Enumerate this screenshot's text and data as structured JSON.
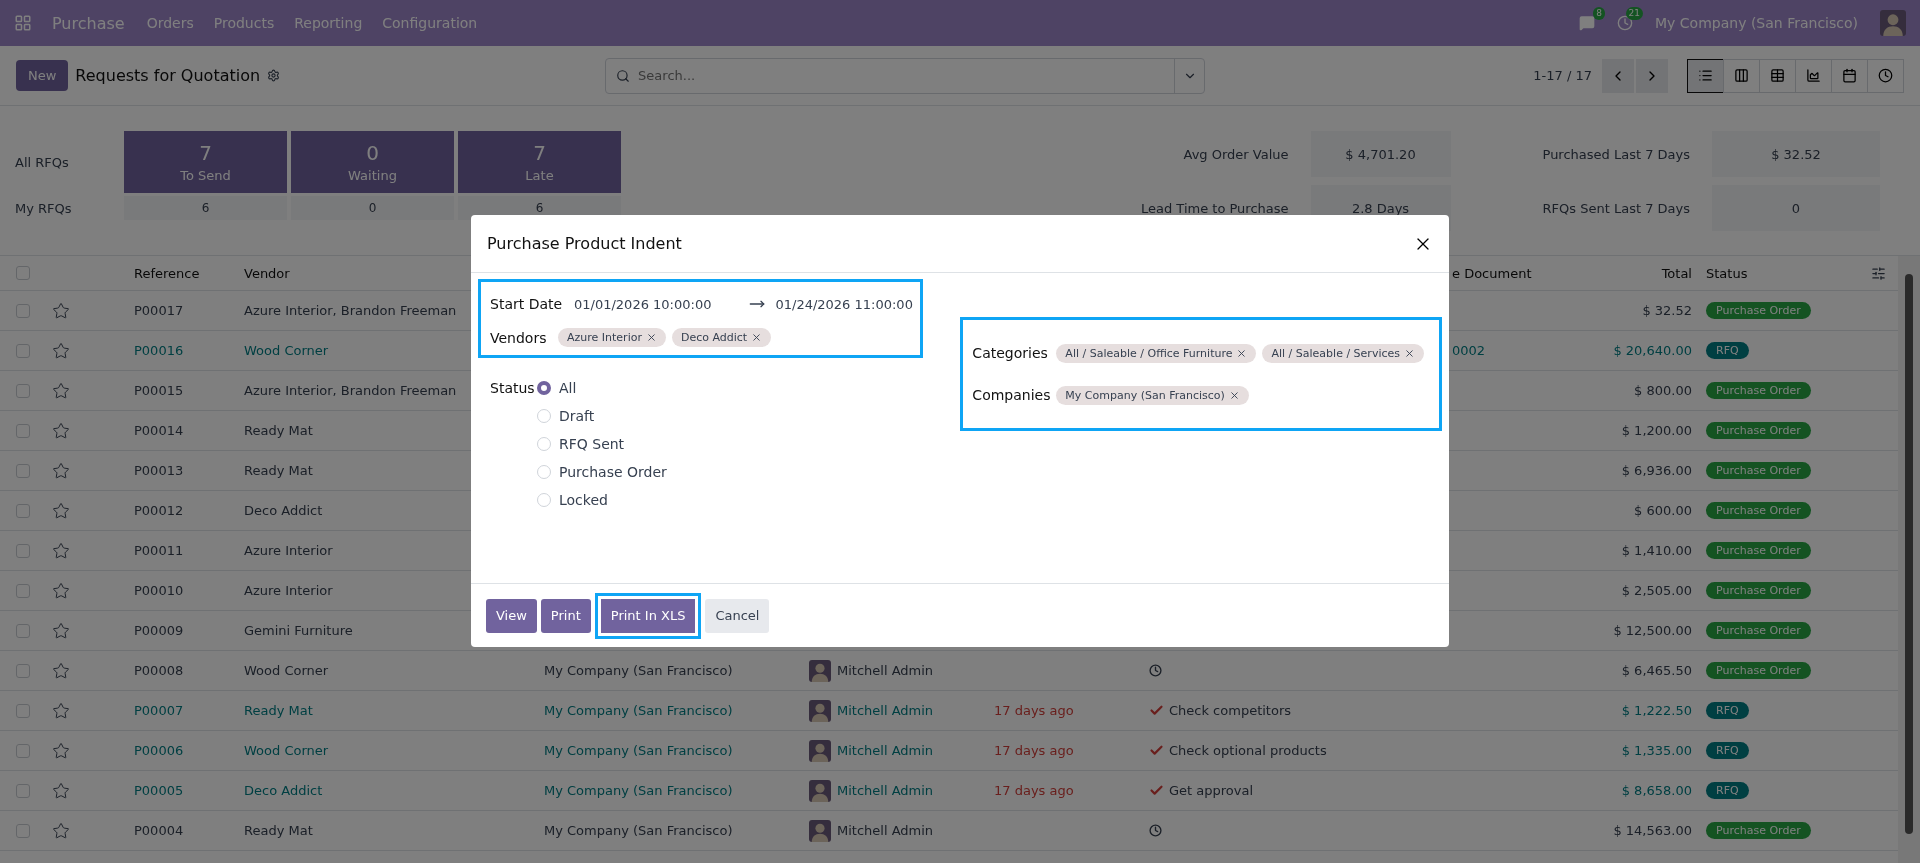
{
  "navbar": {
    "app": "Purchase",
    "menus": [
      "Orders",
      "Products",
      "Reporting",
      "Configuration"
    ],
    "messages_count": "8",
    "activities_count": "21",
    "company": "My Company (San Francisco)"
  },
  "control_panel": {
    "new_button": "New",
    "title": "Requests for Quotation",
    "search": {
      "placeholder": "Search..."
    },
    "pager": "1-17 / 17",
    "views": [
      {
        "kind": "list",
        "selected": true
      },
      {
        "kind": "kanban",
        "selected": false
      },
      {
        "kind": "pivot",
        "selected": false
      },
      {
        "kind": "graph",
        "selected": false
      },
      {
        "kind": "calendar",
        "selected": false
      },
      {
        "kind": "activity",
        "selected": false
      }
    ]
  },
  "dashboard": {
    "row_labels": [
      "All RFQs",
      "My RFQs"
    ],
    "tiles": [
      {
        "count": "7",
        "label": "To Send",
        "mine": "6"
      },
      {
        "count": "0",
        "label": "Waiting",
        "mine": "0"
      },
      {
        "count": "7",
        "label": "Late",
        "mine": "6"
      }
    ],
    "stats": [
      {
        "label": "Avg Order Value",
        "value": "$ 4,701.20"
      },
      {
        "label": "Purchased Last 7 Days",
        "value": "$ 32.52"
      },
      {
        "label": "Lead Time to Purchase",
        "value": "2.8 Days"
      },
      {
        "label": "RFQs Sent Last 7 Days",
        "value": "0"
      }
    ]
  },
  "table": {
    "all_checked": false,
    "columns": [
      "Reference",
      "Vendor",
      "e Document",
      "Total",
      "Status"
    ],
    "rows": [
      {
        "checked": false,
        "reference": "P00017",
        "vendor": "Azure Interior, Brandon Freeman",
        "total": "$ 32.52",
        "status": {
          "label": "Purchase Order",
          "kind": "purchase_order"
        }
      },
      {
        "checked": false,
        "reference": "P00016",
        "vendor": "Wood Corner",
        "source": "0002",
        "total": "$ 20,640.00",
        "status": {
          "label": "RFQ",
          "kind": "rfq"
        }
      },
      {
        "checked": false,
        "reference": "P00015",
        "vendor": "Azure Interior, Brandon Freeman",
        "total": "$ 800.00",
        "status": {
          "label": "Purchase Order",
          "kind": "purchase_order"
        }
      },
      {
        "checked": false,
        "reference": "P00014",
        "vendor": "Ready Mat",
        "total": "$ 1,200.00",
        "status": {
          "label": "Purchase Order",
          "kind": "purchase_order"
        }
      },
      {
        "checked": false,
        "reference": "P00013",
        "vendor": "Ready Mat",
        "total": "$ 6,936.00",
        "status": {
          "label": "Purchase Order",
          "kind": "purchase_order"
        }
      },
      {
        "checked": false,
        "reference": "P00012",
        "vendor": "Deco Addict",
        "total": "$ 600.00",
        "status": {
          "label": "Purchase Order",
          "kind": "purchase_order"
        }
      },
      {
        "checked": false,
        "reference": "P00011",
        "vendor": "Azure Interior",
        "total": "$ 1,410.00",
        "status": {
          "label": "Purchase Order",
          "kind": "purchase_order"
        }
      },
      {
        "checked": false,
        "reference": "P00010",
        "vendor": "Azure Interior",
        "total": "$ 2,505.00",
        "status": {
          "label": "Purchase Order",
          "kind": "purchase_order"
        }
      },
      {
        "checked": false,
        "reference": "P00009",
        "vendor": "Gemini Furniture",
        "total": "$ 12,500.00",
        "status": {
          "label": "Purchase Order",
          "kind": "purchase_order"
        }
      },
      {
        "checked": false,
        "reference": "P00008",
        "vendor": "Wood Corner",
        "company": "My Company (San Francisco)",
        "buyer": "Mitchell Admin",
        "activity": {
          "kind": "clock"
        },
        "total": "$ 6,465.50",
        "status": {
          "label": "Purchase Order",
          "kind": "purchase_order"
        }
      },
      {
        "checked": false,
        "reference": "P00007",
        "vendor": "Ready Mat",
        "company": "My Company (San Francisco)",
        "buyer": "Mitchell Admin",
        "deadline": "17 days ago",
        "activity": {
          "kind": "check",
          "text": "Check competitors"
        },
        "total": "$ 1,222.50",
        "status": {
          "label": "RFQ",
          "kind": "rfq"
        }
      },
      {
        "checked": false,
        "reference": "P00006",
        "vendor": "Wood Corner",
        "company": "My Company (San Francisco)",
        "buyer": "Mitchell Admin",
        "deadline": "17 days ago",
        "activity": {
          "kind": "check",
          "text": "Check optional products"
        },
        "total": "$ 1,335.00",
        "status": {
          "label": "RFQ",
          "kind": "rfq"
        }
      },
      {
        "checked": false,
        "reference": "P00005",
        "vendor": "Deco Addict",
        "company": "My Company (San Francisco)",
        "buyer": "Mitchell Admin",
        "deadline": "17 days ago",
        "activity": {
          "kind": "check",
          "text": "Get approval"
        },
        "total": "$ 8,658.00",
        "status": {
          "label": "RFQ",
          "kind": "rfq"
        }
      },
      {
        "checked": false,
        "reference": "P00004",
        "vendor": "Ready Mat",
        "company": "My Company (San Francisco)",
        "buyer": "Mitchell Admin",
        "activity": {
          "kind": "clock"
        },
        "total": "$ 14,563.00",
        "status": {
          "label": "Purchase Order",
          "kind": "purchase_order"
        }
      }
    ]
  },
  "dialog": {
    "title": "Purchase Product Indent",
    "start_date": {
      "label": "Start Date",
      "from": "01/01/2026 10:00:00",
      "to": "01/24/2026 11:00:00"
    },
    "vendors": {
      "label": "Vendors",
      "tags": [
        "Azure Interior",
        "Deco Addict"
      ]
    },
    "status": {
      "label": "Status",
      "options": [
        {
          "label": "All",
          "selected": true
        },
        {
          "label": "Draft",
          "selected": false
        },
        {
          "label": "RFQ Sent",
          "selected": false
        },
        {
          "label": "Purchase Order",
          "selected": false
        },
        {
          "label": "Locked",
          "selected": false
        }
      ]
    },
    "categories": {
      "label": "Categories",
      "tags": [
        "All / Saleable / Office Furniture",
        "All / Saleable / Services"
      ]
    },
    "companies": {
      "label": "Companies",
      "tags": [
        "My Company (San Francisco)"
      ]
    },
    "buttons": [
      {
        "label": "View",
        "kind": "primary",
        "highlighted": false
      },
      {
        "label": "Print",
        "kind": "primary",
        "highlighted": false
      },
      {
        "label": "Print In XLS",
        "kind": "primary",
        "highlighted": true
      },
      {
        "label": "Cancel",
        "kind": "secondary",
        "highlighted": false
      }
    ]
  }
}
